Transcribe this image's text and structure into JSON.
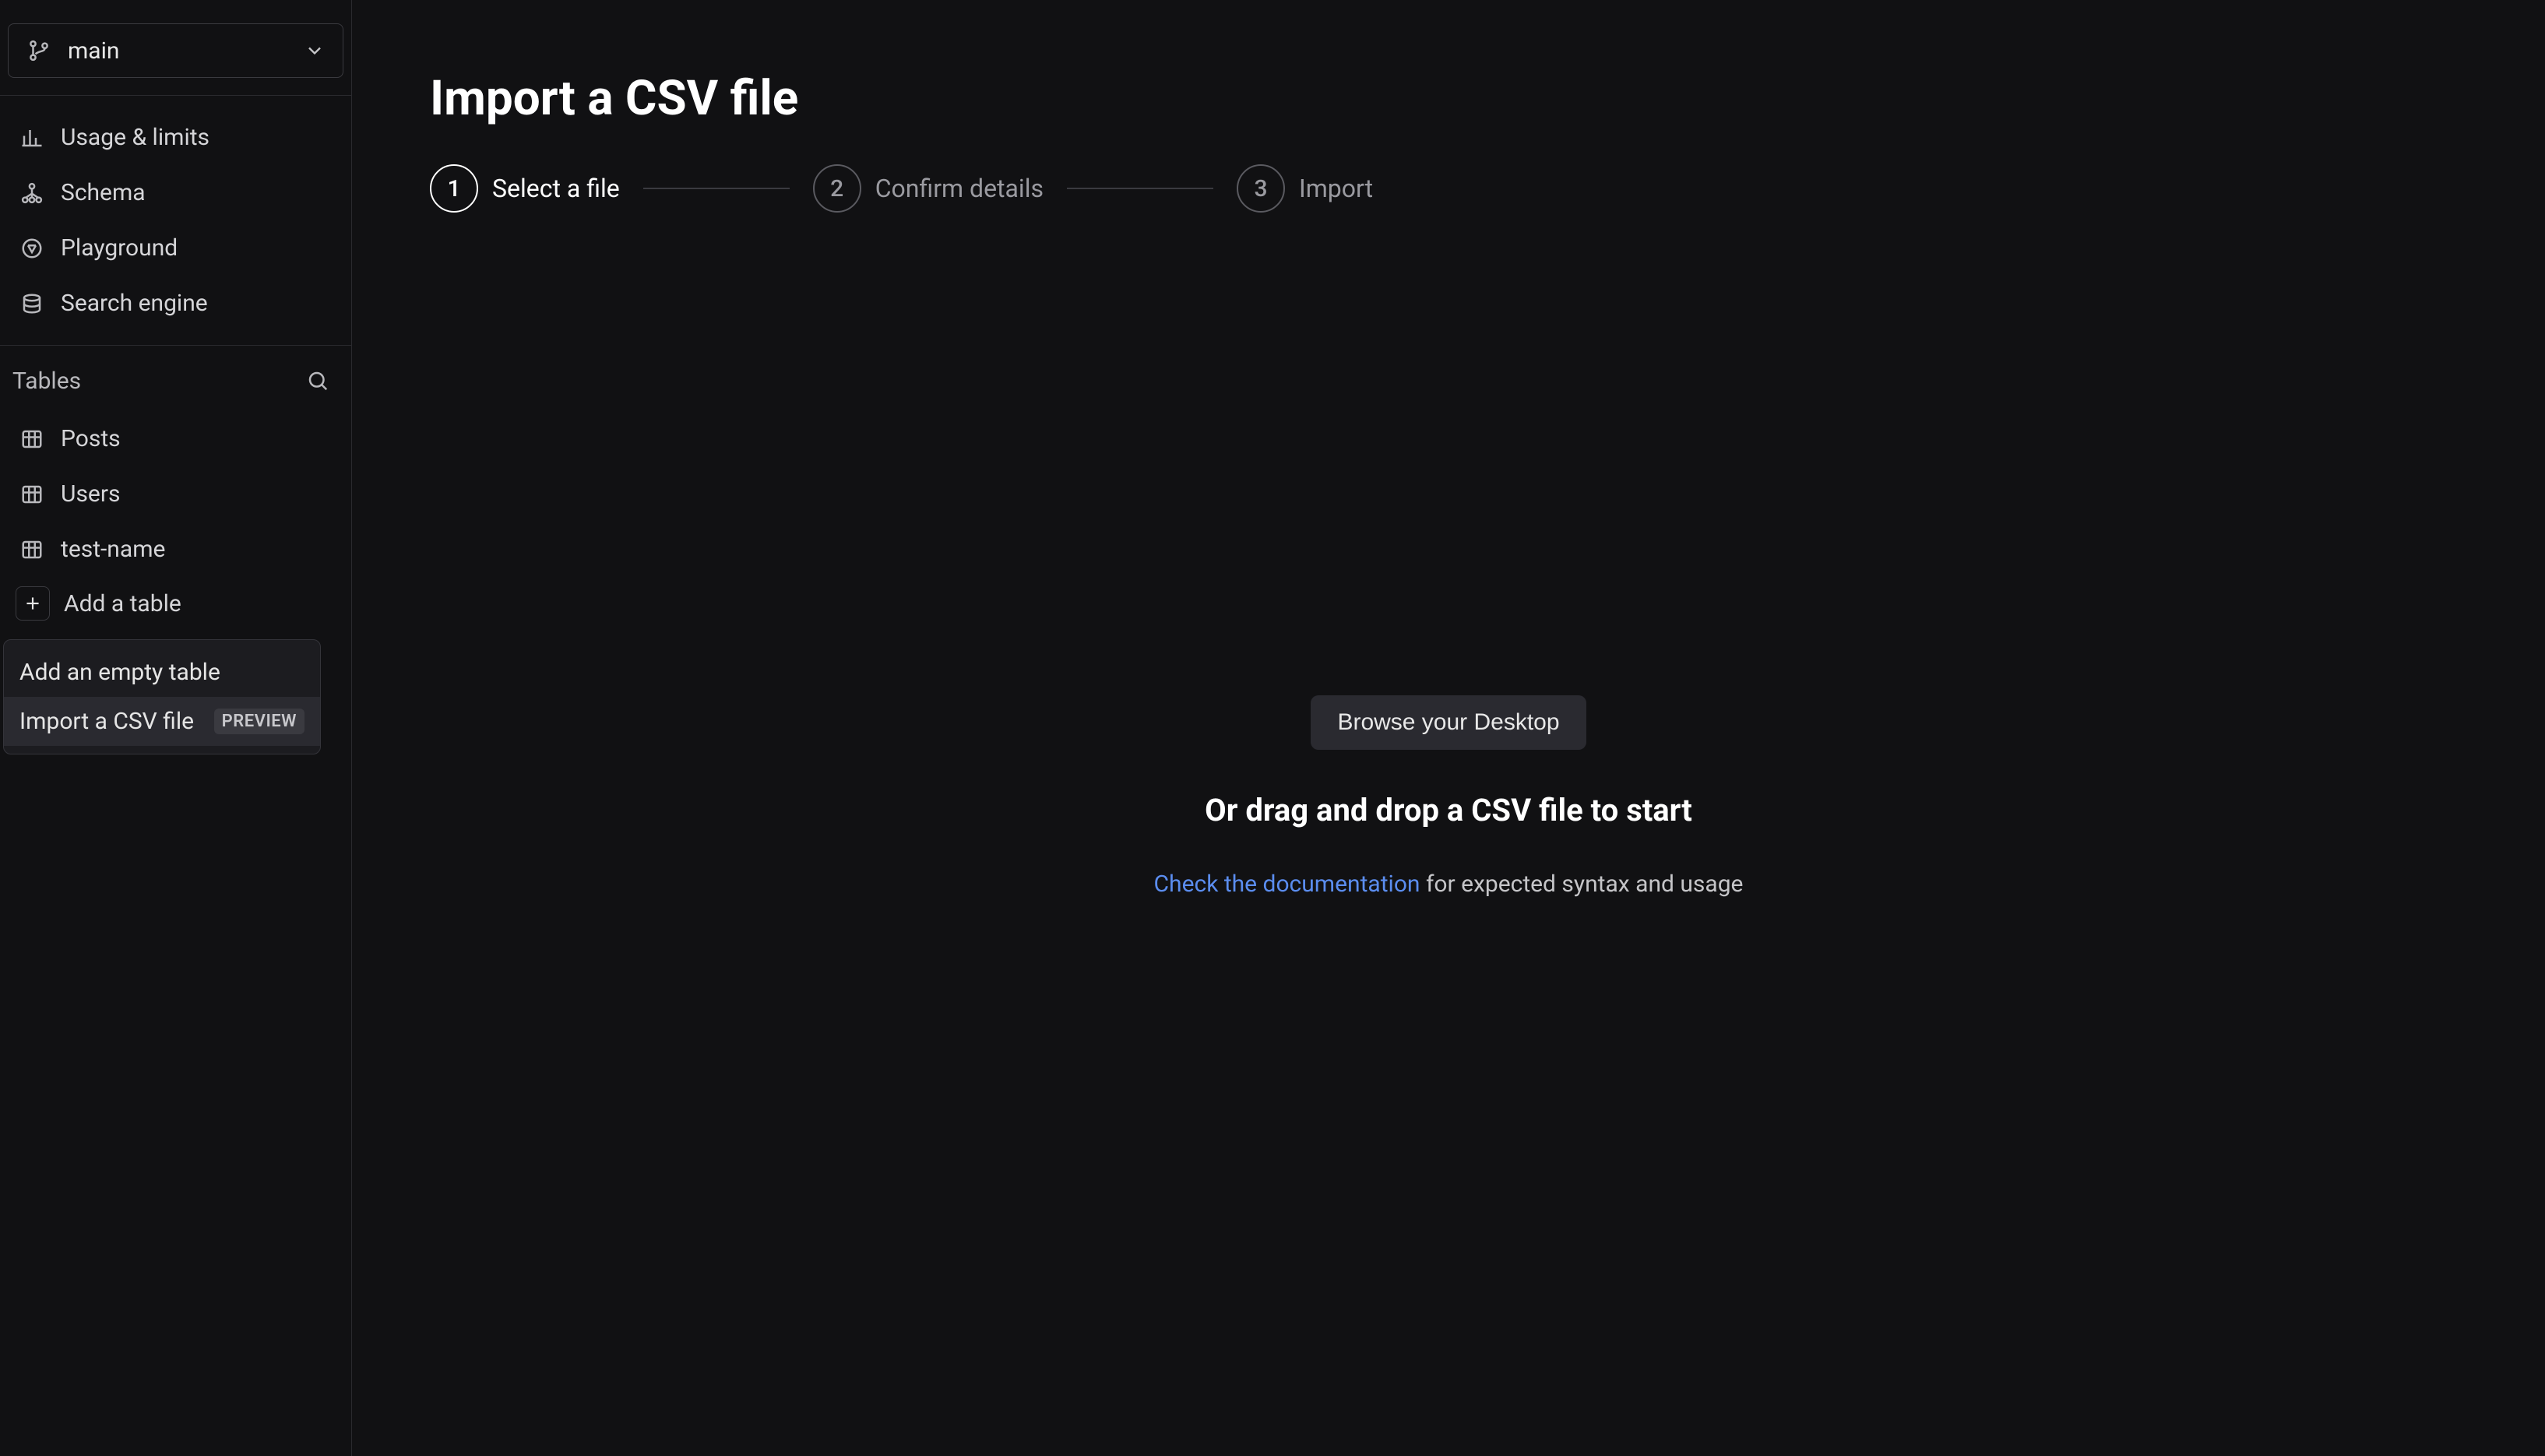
{
  "branch": {
    "name": "main"
  },
  "nav": {
    "items": [
      {
        "label": "Usage & limits",
        "icon": "chart-icon"
      },
      {
        "label": "Schema",
        "icon": "schema-icon"
      },
      {
        "label": "Playground",
        "icon": "playground-icon"
      },
      {
        "label": "Search engine",
        "icon": "search-engine-icon"
      }
    ]
  },
  "tables": {
    "header": "Tables",
    "items": [
      {
        "label": "Posts"
      },
      {
        "label": "Users"
      },
      {
        "label": "test-name"
      }
    ],
    "add_label": "Add a table"
  },
  "add_menu": {
    "empty_label": "Add an empty table",
    "import_label": "Import a CSV file",
    "preview_badge": "PREVIEW"
  },
  "page": {
    "title": "Import a CSV file"
  },
  "steps": [
    {
      "num": "1",
      "label": "Select a file"
    },
    {
      "num": "2",
      "label": "Confirm details"
    },
    {
      "num": "3",
      "label": "Import"
    }
  ],
  "drop": {
    "browse_label": "Browse your Desktop",
    "drag_text": "Or drag and drop a CSV file to start",
    "doc_link": "Check the documentation",
    "doc_suffix": " for expected syntax and usage"
  }
}
